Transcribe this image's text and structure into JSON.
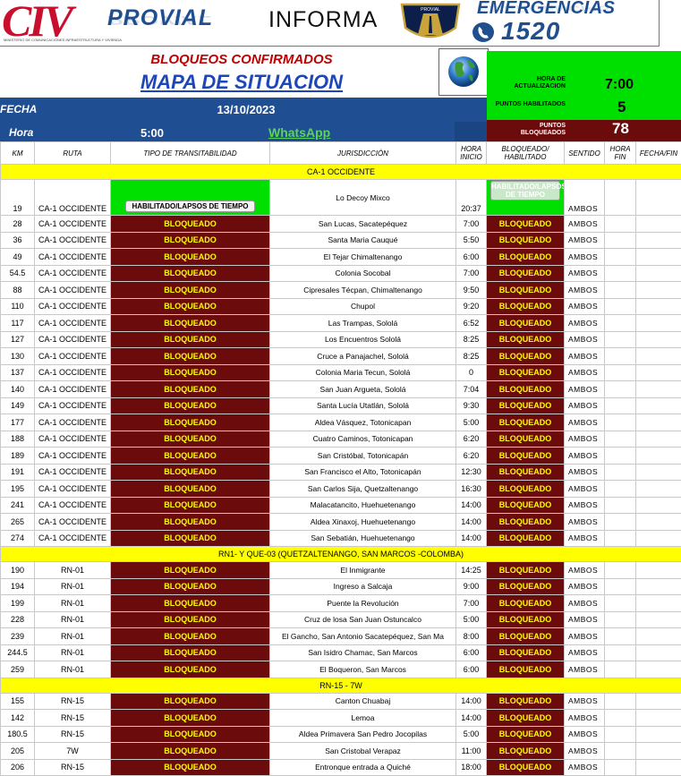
{
  "banner": {
    "civ_letters": "CIV",
    "civ_sub": "MINISTERIO DE COMUNICACIONES INFRAESTRUCTURA Y VIVIENDA",
    "provial": "PROVIAL",
    "informa": "INFORMA",
    "shield_text": "PROVIAL",
    "emergencias": "EMERGENCIAS",
    "emergency_number": "1520"
  },
  "header": {
    "bloqueos_title": "BLOQUEOS CONFIRMADOS",
    "mapa_title": "MAPA DE SITUACION",
    "fecha_label": "FECHA",
    "fecha_value": "13/10/2023",
    "hora_label": "Hora",
    "hora_value": "5:00",
    "whatsapp_link": "WhatsApp",
    "update_label": "HORA DE ACTUALIZACION",
    "update_value": "7:00",
    "habilitados_label": "PUNTOS HABILITADOS",
    "habilitados_value": "5",
    "bloqueados_label": "PUNTOS BLOQUEADOS",
    "bloqueados_value": "78"
  },
  "columns": {
    "km": "KM",
    "ruta": "RUTA",
    "tipo": "TIPO DE TRANSITABILIDAD",
    "jurisdiccion": "JURISDICCIÓN",
    "hora_inicio": "HORA INICIO",
    "estado": "BLOQUEADO/ HABILITADO",
    "sentido": "SENTIDO",
    "hora_fin": "HORA FIN",
    "fecha_fin": "FECHA/FIN"
  },
  "colors": {
    "blocked_bg": "#6b0b0b",
    "blocked_text": "#ffff00",
    "enabled_bg": "#00e000",
    "header_blue": "#1f4e92",
    "section_yellow": "#ffff00"
  },
  "sections": [
    {
      "title": "CA-1 OCCIDENTE",
      "rows": [
        {
          "km": "19",
          "ruta": "CA-1 OCCIDENTE",
          "tipo": "HABILITADO/LAPSOS DE TIEMPO",
          "jurisdiccion": "Lo Decoy Mixco",
          "hora": "20:37",
          "estado": "HABILITADO/LAPSOS DE TIEMPO",
          "sentido": "AMBOS"
        },
        {
          "km": "28",
          "ruta": "CA-1 OCCIDENTE",
          "tipo": "BLOQUEADO",
          "jurisdiccion": "San Lucas, Sacatepéquez",
          "hora": "7:00",
          "estado": "BLOQUEADO",
          "sentido": "AMBOS"
        },
        {
          "km": "36",
          "ruta": "CA-1 OCCIDENTE",
          "tipo": "BLOQUEADO",
          "jurisdiccion": "Santa Maria Cauqué",
          "hora": "5:50",
          "estado": "BLOQUEADO",
          "sentido": "AMBOS"
        },
        {
          "km": "49",
          "ruta": "CA-1 OCCIDENTE",
          "tipo": "BLOQUEADO",
          "jurisdiccion": "El Tejar Chimaltenango",
          "hora": "6:00",
          "estado": "BLOQUEADO",
          "sentido": "AMBOS"
        },
        {
          "km": "54.5",
          "ruta": "CA-1 OCCIDENTE",
          "tipo": "BLOQUEADO",
          "jurisdiccion": "Colonia Socobal",
          "hora": "7:00",
          "estado": "BLOQUEADO",
          "sentido": "AMBOS"
        },
        {
          "km": "88",
          "ruta": "CA-1 OCCIDENTE",
          "tipo": "BLOQUEADO",
          "jurisdiccion": "Cipresales Técpan, Chimaltenango",
          "hora": "9:50",
          "estado": "BLOQUEADO",
          "sentido": "AMBOS"
        },
        {
          "km": "110",
          "ruta": "CA-1 OCCIDENTE",
          "tipo": "BLOQUEADO",
          "jurisdiccion": "Chupol",
          "hora": "9:20",
          "estado": "BLOQUEADO",
          "sentido": "AMBOS"
        },
        {
          "km": "117",
          "ruta": "CA-1 OCCIDENTE",
          "tipo": "BLOQUEADO",
          "jurisdiccion": "Las Trampas, Sololá",
          "hora": "6:52",
          "estado": "BLOQUEADO",
          "sentido": "AMBOS"
        },
        {
          "km": "127",
          "ruta": "CA-1 OCCIDENTE",
          "tipo": "BLOQUEADO",
          "jurisdiccion": "Los Encuentros Sololá",
          "hora": "8:25",
          "estado": "BLOQUEADO",
          "sentido": "AMBOS"
        },
        {
          "km": "130",
          "ruta": "CA-1 OCCIDENTE",
          "tipo": "BLOQUEADO",
          "jurisdiccion": "Cruce a Panajachel, Sololá",
          "hora": "8:25",
          "estado": "BLOQUEADO",
          "sentido": "AMBOS"
        },
        {
          "km": "137",
          "ruta": "CA-1 OCCIDENTE",
          "tipo": "BLOQUEADO",
          "jurisdiccion": "Colonia Maria Tecun, Sololá",
          "hora": "0",
          "estado": "BLOQUEADO",
          "sentido": "AMBOS"
        },
        {
          "km": "140",
          "ruta": "CA-1 OCCIDENTE",
          "tipo": "BLOQUEADO",
          "jurisdiccion": "San Juan Argueta, Sololá",
          "hora": "7:04",
          "estado": "BLOQUEADO",
          "sentido": "AMBOS"
        },
        {
          "km": "149",
          "ruta": "CA-1 OCCIDENTE",
          "tipo": "BLOQUEADO",
          "jurisdiccion": "Santa Lucía Utatlán, Sololá",
          "hora": "9:30",
          "estado": "BLOQUEADO",
          "sentido": "AMBOS"
        },
        {
          "km": "177",
          "ruta": "CA-1 OCCIDENTE",
          "tipo": "BLOQUEADO",
          "jurisdiccion": "Aldea Vásquez, Totonicapan",
          "hora": "5:00",
          "estado": "BLOQUEADO",
          "sentido": "AMBOS"
        },
        {
          "km": "188",
          "ruta": "CA-1 OCCIDENTE",
          "tipo": "BLOQUEADO",
          "jurisdiccion": "Cuatro Caminos, Totonicapan",
          "hora": "6:20",
          "estado": "BLOQUEADO",
          "sentido": "AMBOS"
        },
        {
          "km": "189",
          "ruta": "CA-1 OCCIDENTE",
          "tipo": "BLOQUEADO",
          "jurisdiccion": "San Cristóbal, Totonicapán",
          "hora": "6:20",
          "estado": "BLOQUEADO",
          "sentido": "AMBOS"
        },
        {
          "km": "191",
          "ruta": "CA-1 OCCIDENTE",
          "tipo": "BLOQUEADO",
          "jurisdiccion": "San Francisco el Alto, Totonicapán",
          "hora": "12:30",
          "estado": "BLOQUEADO",
          "sentido": "AMBOS"
        },
        {
          "km": "195",
          "ruta": "CA-1 OCCIDENTE",
          "tipo": "BLOQUEADO",
          "jurisdiccion": "San Carlos Sija, Quetzaltenango",
          "hora": "16:30",
          "estado": "BLOQUEADO",
          "sentido": "AMBOS"
        },
        {
          "km": "241",
          "ruta": "CA-1 OCCIDENTE",
          "tipo": "BLOQUEADO",
          "jurisdiccion": "Malacatancito, Huehuetenango",
          "hora": "14:00",
          "estado": "BLOQUEADO",
          "sentido": "AMBOS"
        },
        {
          "km": "265",
          "ruta": "CA-1 OCCIDENTE",
          "tipo": "BLOQUEADO",
          "jurisdiccion": "Aldea Xinaxoj, Huehuetenango",
          "hora": "14:00",
          "estado": "BLOQUEADO",
          "sentido": "AMBOS"
        },
        {
          "km": "274",
          "ruta": "CA-1 OCCIDENTE",
          "tipo": "BLOQUEADO",
          "jurisdiccion": "San Sebatián, Huehuetenango",
          "hora": "14:00",
          "estado": "BLOQUEADO",
          "sentido": "AMBOS"
        }
      ]
    },
    {
      "title": "RN1- Y QUE-03 (QUETZALTENANGO, SAN MARCOS -COLOMBA)",
      "rows": [
        {
          "km": "190",
          "ruta": "RN-01",
          "tipo": "BLOQUEADO",
          "jurisdiccion": "El Inmigrante",
          "hora": "14:25",
          "estado": "BLOQUEADO",
          "sentido": "AMBOS"
        },
        {
          "km": "194",
          "ruta": "RN-01",
          "tipo": "BLOQUEADO",
          "jurisdiccion": "Ingreso a Salcaja",
          "hora": "9:00",
          "estado": "BLOQUEADO",
          "sentido": "AMBOS"
        },
        {
          "km": "199",
          "ruta": "RN-01",
          "tipo": "BLOQUEADO",
          "jurisdiccion": "Puente la Revolución",
          "hora": "7:00",
          "estado": "BLOQUEADO",
          "sentido": "AMBOS"
        },
        {
          "km": "228",
          "ruta": "RN-01",
          "tipo": "BLOQUEADO",
          "jurisdiccion": "Cruz de losa San Juan Ostuncalco",
          "hora": "5:00",
          "estado": "BLOQUEADO",
          "sentido": "AMBOS"
        },
        {
          "km": "239",
          "ruta": "RN-01",
          "tipo": "BLOQUEADO",
          "jurisdiccion": "El Gancho, San Antonio Sacatepéquez, San Ma",
          "hora": "8:00",
          "estado": "BLOQUEADO",
          "sentido": "AMBOS"
        },
        {
          "km": "244.5",
          "ruta": "RN-01",
          "tipo": "BLOQUEADO",
          "jurisdiccion": "San Isidro Chamac, San Marcos",
          "hora": "6:00",
          "estado": "BLOQUEADO",
          "sentido": "AMBOS"
        },
        {
          "km": "259",
          "ruta": "RN-01",
          "tipo": "BLOQUEADO",
          "jurisdiccion": "El Boqueron, San Marcos",
          "hora": "6:00",
          "estado": "BLOQUEADO",
          "sentido": "AMBOS"
        }
      ]
    },
    {
      "title": "RN-15 - 7W",
      "rows": [
        {
          "km": "155",
          "ruta": "RN-15",
          "tipo": "BLOQUEADO",
          "jurisdiccion": "Canton Chuabaj",
          "hora": "14:00",
          "estado": "BLOQUEADO",
          "sentido": "AMBOS"
        },
        {
          "km": "142",
          "ruta": "RN-15",
          "tipo": "BLOQUEADO",
          "jurisdiccion": "Lemoa",
          "hora": "14:00",
          "estado": "BLOQUEADO",
          "sentido": "AMBOS"
        },
        {
          "km": "180.5",
          "ruta": "RN-15",
          "tipo": "BLOQUEADO",
          "jurisdiccion": "Aldea Primavera San Pedro Jocopilas",
          "hora": "5:00",
          "estado": "BLOQUEADO",
          "sentido": "AMBOS"
        },
        {
          "km": "205",
          "ruta": "7W",
          "tipo": "BLOQUEADO",
          "jurisdiccion": "San Cristobal Verapaz",
          "hora": "11:00",
          "estado": "BLOQUEADO",
          "sentido": "AMBOS"
        },
        {
          "km": "206",
          "ruta": "RN-15",
          "tipo": "BLOQUEADO",
          "jurisdiccion": "Entronque entrada a Quiché",
          "hora": "18:00",
          "estado": "BLOQUEADO",
          "sentido": "AMBOS"
        }
      ]
    }
  ]
}
